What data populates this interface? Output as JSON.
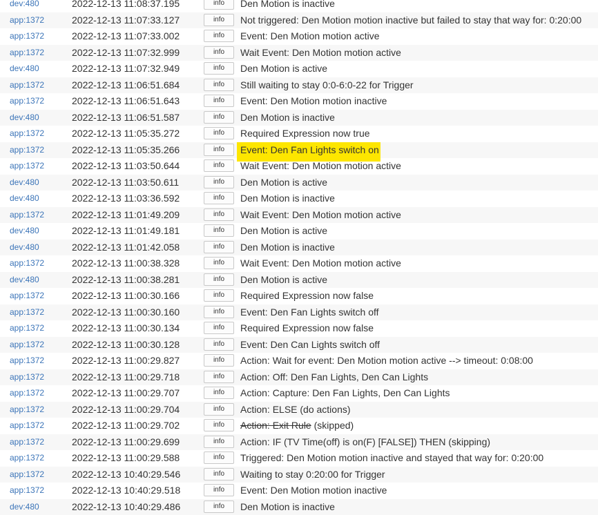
{
  "log": {
    "rows": [
      {
        "source": "dev:480",
        "time": "2022-12-13 11:08:37.195",
        "level": "info",
        "message": "Den Motion is inactive"
      },
      {
        "source": "app:1372",
        "time": "2022-12-13 11:07:33.127",
        "level": "info",
        "message": "Not triggered: Den Motion motion inactive but failed to stay that way for: 0:20:00"
      },
      {
        "source": "app:1372",
        "time": "2022-12-13 11:07:33.002",
        "level": "info",
        "message": "Event: Den Motion motion active"
      },
      {
        "source": "app:1372",
        "time": "2022-12-13 11:07:32.999",
        "level": "info",
        "message": "Wait Event: Den Motion motion active"
      },
      {
        "source": "dev:480",
        "time": "2022-12-13 11:07:32.949",
        "level": "info",
        "message": "Den Motion is active"
      },
      {
        "source": "app:1372",
        "time": "2022-12-13 11:06:51.684",
        "level": "info",
        "message": "Still waiting to stay 0:0-6:0-22 for Trigger"
      },
      {
        "source": "app:1372",
        "time": "2022-12-13 11:06:51.643",
        "level": "info",
        "message": "Event: Den Motion motion inactive"
      },
      {
        "source": "dev:480",
        "time": "2022-12-13 11:06:51.587",
        "level": "info",
        "message": "Den Motion is inactive"
      },
      {
        "source": "app:1372",
        "time": "2022-12-13 11:05:35.272",
        "level": "info",
        "message": "Required Expression now true"
      },
      {
        "source": "app:1372",
        "time": "2022-12-13 11:05:35.266",
        "level": "info",
        "message": "Event: Den Fan Lights switch on",
        "highlighted": true
      },
      {
        "source": "app:1372",
        "time": "2022-12-13 11:03:50.644",
        "level": "info",
        "message": "Wait Event: Den Motion motion active"
      },
      {
        "source": "dev:480",
        "time": "2022-12-13 11:03:50.611",
        "level": "info",
        "message": "Den Motion is active"
      },
      {
        "source": "dev:480",
        "time": "2022-12-13 11:03:36.592",
        "level": "info",
        "message": "Den Motion is inactive"
      },
      {
        "source": "app:1372",
        "time": "2022-12-13 11:01:49.209",
        "level": "info",
        "message": "Wait Event: Den Motion motion active"
      },
      {
        "source": "dev:480",
        "time": "2022-12-13 11:01:49.181",
        "level": "info",
        "message": "Den Motion is active"
      },
      {
        "source": "dev:480",
        "time": "2022-12-13 11:01:42.058",
        "level": "info",
        "message": "Den Motion is inactive"
      },
      {
        "source": "app:1372",
        "time": "2022-12-13 11:00:38.328",
        "level": "info",
        "message": "Wait Event: Den Motion motion active"
      },
      {
        "source": "dev:480",
        "time": "2022-12-13 11:00:38.281",
        "level": "info",
        "message": "Den Motion is active"
      },
      {
        "source": "app:1372",
        "time": "2022-12-13 11:00:30.166",
        "level": "info",
        "message": "Required Expression now false"
      },
      {
        "source": "app:1372",
        "time": "2022-12-13 11:00:30.160",
        "level": "info",
        "message": "Event: Den Fan Lights switch off"
      },
      {
        "source": "app:1372",
        "time": "2022-12-13 11:00:30.134",
        "level": "info",
        "message": "Required Expression now false"
      },
      {
        "source": "app:1372",
        "time": "2022-12-13 11:00:30.128",
        "level": "info",
        "message": "Event: Den Can Lights switch off"
      },
      {
        "source": "app:1372",
        "time": "2022-12-13 11:00:29.827",
        "level": "info",
        "message": "Action: Wait for event: Den Motion motion active --> timeout: 0:08:00"
      },
      {
        "source": "app:1372",
        "time": "2022-12-13 11:00:29.718",
        "level": "info",
        "message": "Action: Off: Den Fan Lights, Den Can Lights"
      },
      {
        "source": "app:1372",
        "time": "2022-12-13 11:00:29.707",
        "level": "info",
        "message": "Action: Capture: Den Fan Lights, Den Can Lights"
      },
      {
        "source": "app:1372",
        "time": "2022-12-13 11:00:29.704",
        "level": "info",
        "message": "Action: ELSE (do actions)"
      },
      {
        "source": "app:1372",
        "time": "2022-12-13 11:00:29.702",
        "level": "info",
        "message": " (skipped)",
        "struck": "Action: Exit Rule"
      },
      {
        "source": "app:1372",
        "time": "2022-12-13 11:00:29.699",
        "level": "info",
        "message": "Action: IF (TV Time(off) is on(F) [FALSE]) THEN (skipping)"
      },
      {
        "source": "app:1372",
        "time": "2022-12-13 11:00:29.588",
        "level": "info",
        "message": "Triggered: Den Motion motion inactive and stayed that way for: 0:20:00"
      },
      {
        "source": "app:1372",
        "time": "2022-12-13 10:40:29.546",
        "level": "info",
        "message": "Waiting to stay 0:20:00 for Trigger"
      },
      {
        "source": "app:1372",
        "time": "2022-12-13 10:40:29.518",
        "level": "info",
        "message": "Event: Den Motion motion inactive"
      },
      {
        "source": "dev:480",
        "time": "2022-12-13 10:40:29.486",
        "level": "info",
        "message": "Den Motion is inactive"
      }
    ]
  },
  "colors": {
    "source_link": "#3b74b8",
    "highlight": "#fde600",
    "text": "#333333"
  }
}
